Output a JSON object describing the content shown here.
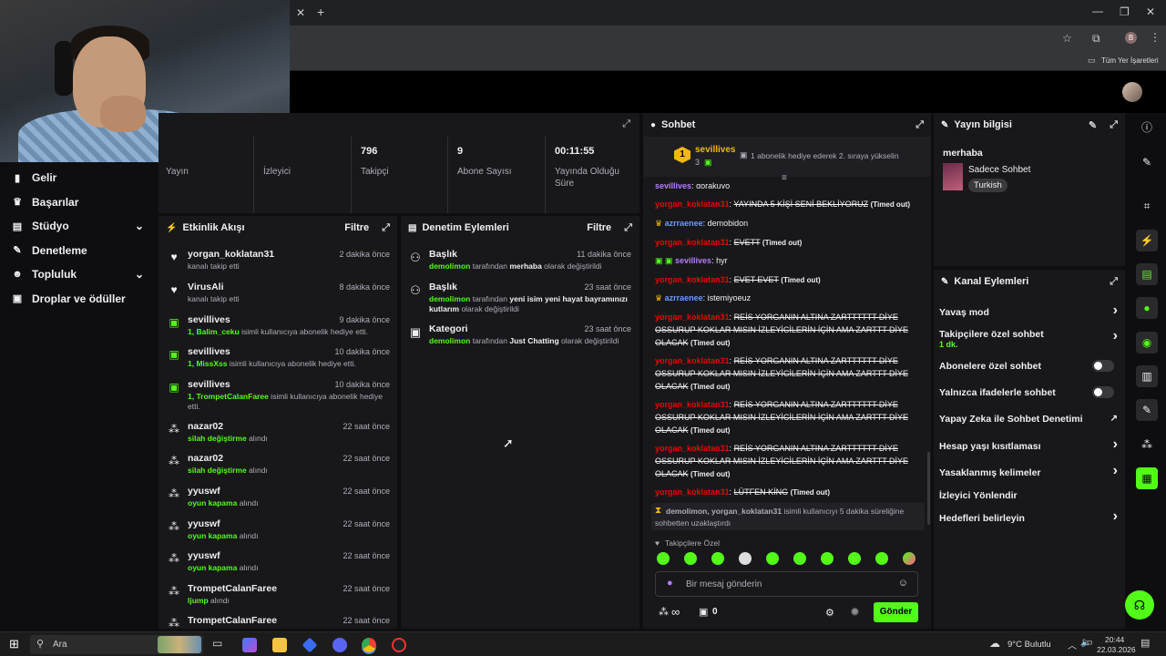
{
  "browser": {
    "bookmarks_label": "Tüm Yer İşaretleri",
    "profile_initial": "B"
  },
  "sidebar": {
    "items": [
      {
        "label": "Gelir",
        "icon": "chart-icon"
      },
      {
        "label": "Başarılar",
        "icon": "trophy-icon"
      },
      {
        "label": "Stüdyo",
        "icon": "studio-icon"
      },
      {
        "label": "Denetleme",
        "icon": "wrench-icon"
      },
      {
        "label": "Topluluk",
        "icon": "people-icon"
      },
      {
        "label": "Droplar ve ödüller",
        "icon": "gift-icon"
      }
    ]
  },
  "stats": {
    "cells": [
      {
        "value": "",
        "label": "Yayın"
      },
      {
        "value": "",
        "label": "İzleyici"
      },
      {
        "value": "796",
        "label": "Takipçi"
      },
      {
        "value": "9",
        "label": "Abone Sayısı"
      },
      {
        "value": "00:11:55",
        "label": "Yayında Olduğu Süre"
      }
    ]
  },
  "activity": {
    "title": "Etkinlik Akışı",
    "filter": "Filtre",
    "items": [
      {
        "name": "yorgan_koklatan31",
        "time": "2 dakika önce",
        "sub_plain": "kanalı takip etti",
        "sub_green": ""
      },
      {
        "name": "VirusAli",
        "time": "8 dakika önce",
        "sub_plain": "kanalı takip etti",
        "sub_green": ""
      },
      {
        "name": "sevillives",
        "time": "9 dakika önce",
        "sub_green": "1, Balim_ceku",
        "sub_plain": " isimli kullanıcıya abonelik hediye etti."
      },
      {
        "name": "sevillives",
        "time": "10 dakika önce",
        "sub_green": "1, MissXss",
        "sub_plain": " isimli kullanıcıya abonelik hediye etti."
      },
      {
        "name": "sevillives",
        "time": "10 dakika önce",
        "sub_green": "1, TrompetCalanFaree",
        "sub_plain": " isimli kullanıcıya abonelik hediye etti."
      },
      {
        "name": "nazar02",
        "time": "22 saat önce",
        "sub_green": "silah değiştirme",
        "sub_plain": " alındı"
      },
      {
        "name": "nazar02",
        "time": "22 saat önce",
        "sub_green": "silah değiştirme",
        "sub_plain": " alındı"
      },
      {
        "name": "yyuswf",
        "time": "22 saat önce",
        "sub_green": "oyun kapama",
        "sub_plain": " alındı"
      },
      {
        "name": "yyuswf",
        "time": "22 saat önce",
        "sub_green": "oyun kapama",
        "sub_plain": " alındı"
      },
      {
        "name": "yyuswf",
        "time": "22 saat önce",
        "sub_green": "oyun kapama",
        "sub_plain": " alındı"
      },
      {
        "name": "TrompetCalanFaree",
        "time": "22 saat önce",
        "sub_green": "Ijump",
        "sub_plain": " alındı"
      },
      {
        "name": "TrompetCalanFaree",
        "time": "22 saat önce",
        "sub_green": "",
        "sub_plain": ""
      }
    ]
  },
  "moderation": {
    "title": "Denetim Eylemleri",
    "filter": "Filtre",
    "items": [
      {
        "name": "Başlık",
        "time": "11 dakika önce",
        "user": "demolimon",
        "mid": " tarafından ",
        "value": "merhaba",
        "end": " olarak değiştirildi"
      },
      {
        "name": "Başlık",
        "time": "23 saat önce",
        "user": "demolimon",
        "mid": " tarafından ",
        "value": "yeni isim yeni hayat bayramınızı kutlarım",
        "end": " olarak değiştirildi"
      },
      {
        "name": "Kategori",
        "time": "23 saat önce",
        "user": "demolimon",
        "mid": " tarafından ",
        "value": "Just Chatting",
        "end": " olarak değiştirildi"
      }
    ]
  },
  "chat": {
    "title": "Sohbet",
    "pinned_user": "sevillives",
    "pinned_count": "3",
    "pinned_rank": "1",
    "pinned_text": "1 abonelik hediye ederek 2. sıraya yükselin",
    "top_partial": {
      "user": "sevillives",
      "text": "gorakuyo"
    },
    "messages": [
      {
        "user": "yorgan_koklatan31",
        "color": "red",
        "text": "YAYINDA 5 KİŞİ SENİ BEKLİYORUZ",
        "timeout": "(Timed out)"
      },
      {
        "user": "azrraenee",
        "color": "blue",
        "text": "demobidon",
        "timeout": ""
      },
      {
        "user": "yorgan_koklatan31",
        "color": "red",
        "text": "EVETT",
        "timeout": "(Timed out)"
      },
      {
        "user": "sevillives",
        "color": "purple",
        "text": "hyr",
        "timeout": ""
      },
      {
        "user": "yorgan_koklatan31",
        "color": "red",
        "text": "EVET EVET",
        "timeout": "(Timed out)"
      },
      {
        "user": "azrraenee",
        "color": "blue",
        "text": "istemiyoeuz",
        "timeout": ""
      },
      {
        "user": "yorgan_koklatan31",
        "color": "red",
        "text": "REİS YORGANIN ALTINA ZARTTTTTT DİYE OSSURUP KOKLAR MISIN İZLEYİCİLERİN İÇİN AMA ZARTTT DİYE OLACAK",
        "timeout": "(Timed out)"
      },
      {
        "user": "yorgan_koklatan31",
        "color": "red",
        "text": "REİS YORGANIN ALTINA ZARTTTTTT DİYE OSSURUP KOKLAR MISIN İZLEYİCİLERİN İÇİN AMA ZARTTT DİYE OLACAK",
        "timeout": "(Timed out)"
      },
      {
        "user": "yorgan_koklatan31",
        "color": "red",
        "text": "REİS YORGANIN ALTINA ZARTTTTTT DİYE OSSURUP KOKLAR MISIN İZLEYİCİLERİN İÇİN AMA ZARTTT DİYE OLACAK",
        "timeout": "(Timed out)"
      },
      {
        "user": "yorgan_koklatan31",
        "color": "red",
        "text": "REİS YORGANIN ALTINA ZARTTTTTT DİYE OSSURUP KOKLAR MISIN İZLEYİCİLERİN İÇİN AMA ZARTTT DİYE OLACAK",
        "timeout": "(Timed out)"
      },
      {
        "user": "yorgan_koklatan31",
        "color": "red",
        "text": "LÜTFEN KİNG",
        "timeout": "(Timed out)"
      }
    ],
    "system_msg": {
      "users": "demolimon, yorgan_koklatan31",
      "text": " isimli kullanıcıyı 5 dakika süreliğine sohbetten uzaklaştırdı"
    },
    "followers_only": "Takipçilere Özel",
    "input_placeholder": "Bir mesaj gönderin",
    "infinity": "∞",
    "gift_count": "0",
    "send_label": "Gönder"
  },
  "stream_info": {
    "title": "Yayın bilgisi",
    "stream_title": "merhaba",
    "category": "Sadece Sohbet",
    "tag": "Turkish"
  },
  "channel_actions": {
    "title": "Kanal Eylemleri",
    "items": [
      {
        "label": "Yavaş mod",
        "sub": "",
        "control": "chevron"
      },
      {
        "label": "Takipçilere özel sohbet",
        "sub": "1 dk.",
        "control": "chevron"
      },
      {
        "label": "Abonelere özel sohbet",
        "sub": "",
        "control": "toggle"
      },
      {
        "label": "Yalnızca ifadelerle sohbet",
        "sub": "",
        "control": "toggle"
      },
      {
        "label": "Yapay Zeka ile Sohbet Denetimi",
        "sub": "",
        "control": "external"
      },
      {
        "label": "Hesap yaşı kısıtlaması",
        "sub": "",
        "control": "chevron"
      },
      {
        "label": "Yasaklanmış kelimeler",
        "sub": "",
        "control": "chevron"
      },
      {
        "label": "İzleyici Yönlendir",
        "sub": "",
        "control": "none"
      },
      {
        "label": "Hedefleri belirleyin",
        "sub": "",
        "control": "chevron"
      }
    ]
  },
  "taskbar": {
    "search_label": "Ara",
    "weather": "9°C  Bulutlu",
    "time": "20:44",
    "date": "22.03.2026"
  },
  "colors": {
    "accent": "#53fc18",
    "red": "#eb0400",
    "bg": "#0e0e10",
    "panel": "#18181b"
  }
}
